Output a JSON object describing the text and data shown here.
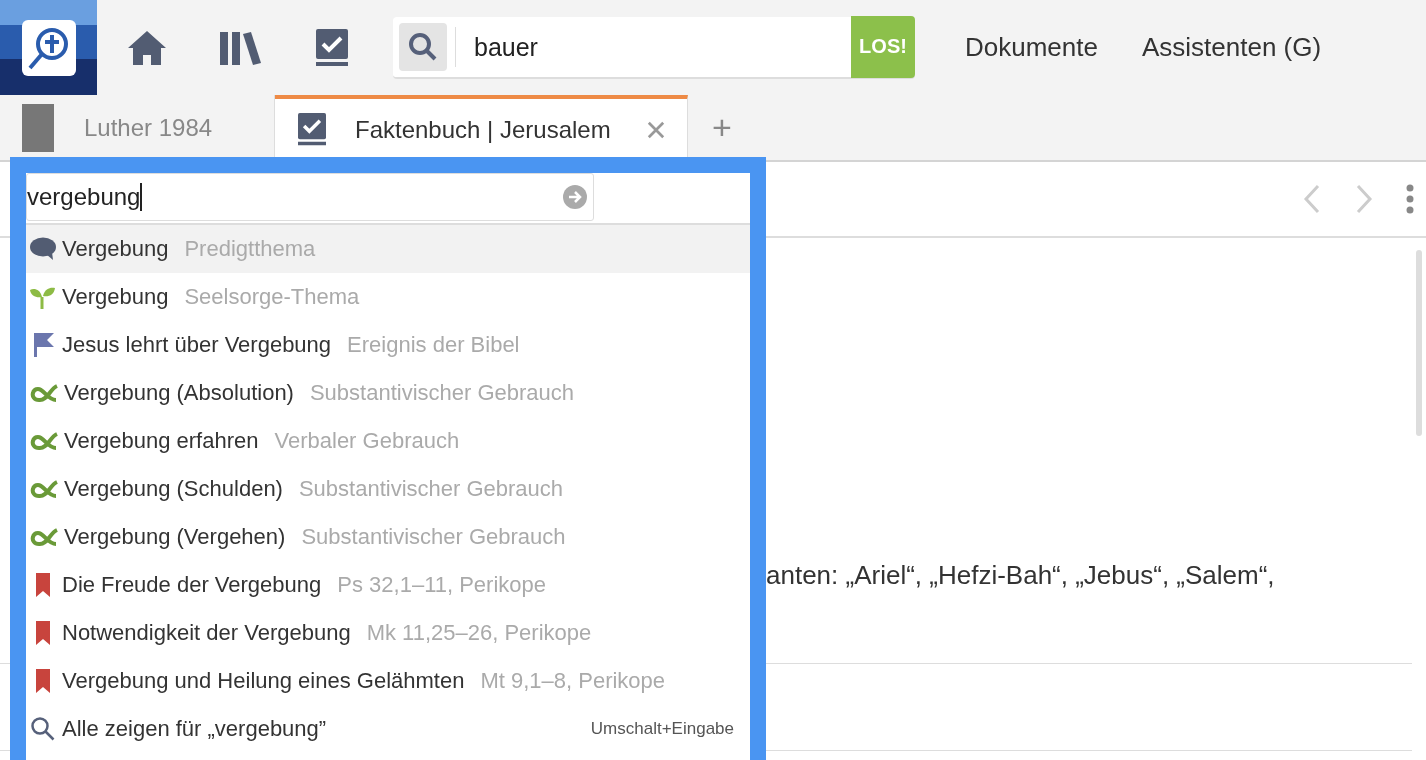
{
  "toolbar": {
    "search": {
      "value": "bauer",
      "button": "LOS!"
    },
    "links": [
      "Dokumente",
      "Assistenten (G)"
    ]
  },
  "tabs": [
    {
      "label": "Luther 1984",
      "kind": "book",
      "selected": false,
      "closable": false
    },
    {
      "label": "Faktenbuch | Jerusalem",
      "kind": "factbook",
      "selected": true,
      "closable": true
    }
  ],
  "tab_add": "+",
  "content": {
    "text": "anten: „Ariel“, „Hefzi-Bah“, „Jebus“, „Salem“,"
  },
  "popup": {
    "query": "vergebung",
    "suggestions": [
      {
        "kind": "sermon",
        "title": "Vergebung",
        "detail": "Predigtthema",
        "selected": true
      },
      {
        "kind": "counseling",
        "title": "Vergebung",
        "detail": "Seelsorge-Thema",
        "selected": false
      },
      {
        "kind": "event",
        "title": "Jesus lehrt über Vergebung",
        "detail": "Ereignis der Bibel",
        "selected": false
      },
      {
        "kind": "sense",
        "title": "Vergebung (Absolution)",
        "detail": "Substantivischer Gebrauch",
        "selected": false
      },
      {
        "kind": "sense",
        "title": "Vergebung erfahren",
        "detail": "Verbaler Gebrauch",
        "selected": false
      },
      {
        "kind": "sense",
        "title": "Vergebung (Schulden)",
        "detail": "Substantivischer Gebrauch",
        "selected": false
      },
      {
        "kind": "sense",
        "title": "Vergebung (Vergehen)",
        "detail": "Substantivischer Gebrauch",
        "selected": false
      },
      {
        "kind": "pericope",
        "title": "Die Freude der Vergebung",
        "detail": "Ps 32,1–11, Perikope",
        "selected": false
      },
      {
        "kind": "pericope",
        "title": "Notwendigkeit der Vergebung",
        "detail": "Mk 11,25–26, Perikope",
        "selected": false
      },
      {
        "kind": "pericope",
        "title": "Vergebung und Heilung eines Gelähmten",
        "detail": "Mt 9,1–8, Perikope",
        "selected": false
      }
    ],
    "show_all": {
      "label": "Alle zeigen für „vergebung”",
      "shortcut": "Umschalt+Eingabe"
    }
  }
}
